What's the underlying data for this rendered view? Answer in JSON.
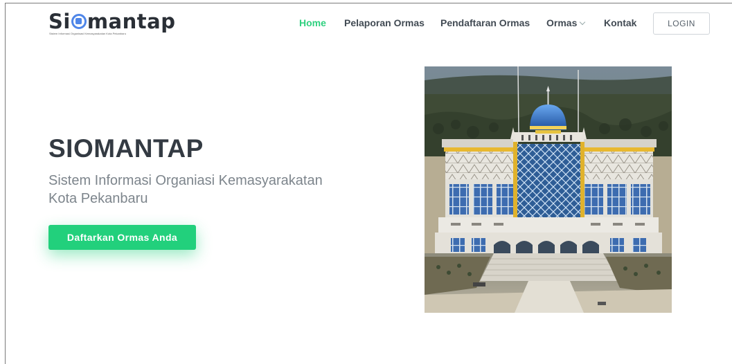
{
  "header": {
    "logo": {
      "text_start": "Si",
      "text_end": "mantap",
      "tagline": "Sistem Informasi Organisasi Kemasyarakatan Kota Pekanbaru"
    },
    "nav": {
      "items": [
        {
          "label": "Home",
          "active": true
        },
        {
          "label": "Pelaporan Ormas",
          "active": false
        },
        {
          "label": "Pendaftaran Ormas",
          "active": false
        },
        {
          "label": "Ormas",
          "active": false,
          "has_dropdown": true
        },
        {
          "label": "Kontak",
          "active": false
        }
      ],
      "login_label": "LOGIN"
    }
  },
  "hero": {
    "title": "SIOMANTAP",
    "subtitle": "Sistem Informasi Organiasi Kemasyarakatan Kota Pekanbaru",
    "cta_label": "Daftarkan Ormas Anda"
  },
  "colors": {
    "accent": "#22d07c",
    "nav_active": "#2fd07f",
    "logo_blue": "#4f86e8",
    "text_dark": "#333a42"
  },
  "icons": {
    "dropdown": "chevron-down-icon"
  }
}
